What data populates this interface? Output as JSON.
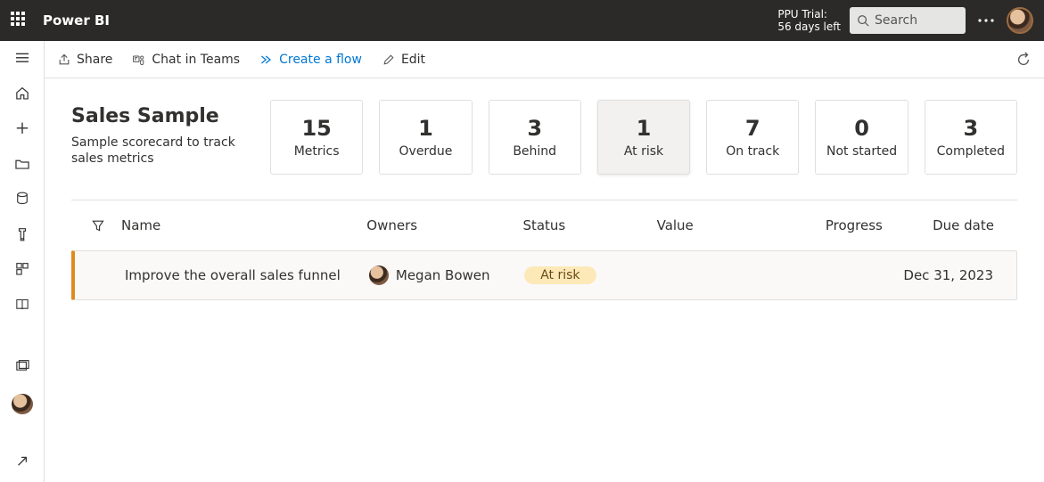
{
  "top": {
    "brand": "Power BI",
    "trial_line1": "PPU Trial:",
    "trial_line2": "56 days left",
    "search_placeholder": "Search"
  },
  "cmd": {
    "share": "Share",
    "chat": "Chat in Teams",
    "flow": "Create a flow",
    "edit": "Edit"
  },
  "scorecard": {
    "title": "Sales Sample",
    "subtitle": "Sample scorecard to track sales metrics",
    "cards": [
      {
        "value": "15",
        "label": "Metrics",
        "active": false
      },
      {
        "value": "1",
        "label": "Overdue",
        "active": false
      },
      {
        "value": "3",
        "label": "Behind",
        "active": false
      },
      {
        "value": "1",
        "label": "At risk",
        "active": true
      },
      {
        "value": "7",
        "label": "On track",
        "active": false
      },
      {
        "value": "0",
        "label": "Not started",
        "active": false
      },
      {
        "value": "3",
        "label": "Completed",
        "active": false
      }
    ]
  },
  "table": {
    "columns": {
      "name": "Name",
      "owners": "Owners",
      "status": "Status",
      "value": "Value",
      "progress": "Progress",
      "due": "Due date"
    },
    "rows": [
      {
        "name": "Improve the overall sales funnel",
        "owner": "Megan Bowen",
        "status": "At risk",
        "value": "",
        "progress": "",
        "due": "Dec 31, 2023"
      }
    ]
  }
}
